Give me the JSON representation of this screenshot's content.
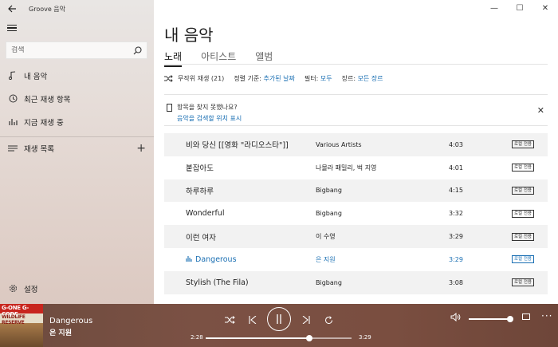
{
  "app": {
    "title": "Groove 음악"
  },
  "window_controls": {
    "minimize": "—",
    "maximize": "☐",
    "close": "✕"
  },
  "sidebar": {
    "search_placeholder": "검색",
    "items": [
      {
        "label": "내 음악",
        "icon": "music-note-icon"
      },
      {
        "label": "최근 재생 항목",
        "icon": "clock-icon"
      },
      {
        "label": "지금 재생 중",
        "icon": "bar-chart-icon"
      },
      {
        "label": "재생 목록",
        "icon": "playlist-icon"
      }
    ],
    "settings_label": "설정"
  },
  "main": {
    "title": "내 음악",
    "tabs": [
      {
        "label": "노래",
        "active": true
      },
      {
        "label": "아티스트",
        "active": false
      },
      {
        "label": "앨범",
        "active": false
      }
    ],
    "filters": {
      "shuffle_label": "무작위 재생 (21)",
      "sort_label": "정렬 기준:",
      "sort_value": "추가된 날짜",
      "filter_label": "필터:",
      "filter_value": "모두",
      "genre_label": "장르:",
      "genre_value": "모든 장르"
    },
    "notice": {
      "title": "항목을 찾지 못했나요?",
      "link": "음악을 검색할 위치 표시"
    },
    "songs": [
      {
        "title": "비와 당신 [[영화 \"라디오스타\"]]",
        "artist": "Various Artists",
        "duration": "4:03",
        "badge": "로컬 전용"
      },
      {
        "title": "붙잡아도",
        "artist": "나몰라 패밀리, 벅 지영",
        "duration": "4:01",
        "badge": "로컬 전용"
      },
      {
        "title": "하루하루",
        "artist": "Bigbang",
        "duration": "4:15",
        "badge": "로컬 전용"
      },
      {
        "title": "Wonderful",
        "artist": "Bigbang",
        "duration": "3:32",
        "badge": "로컬 전용"
      },
      {
        "title": "이런 여자",
        "artist": "이 수영",
        "duration": "3:29",
        "badge": "로컬 전용"
      },
      {
        "title": "Dangerous",
        "artist": "은 지원",
        "duration": "3:29",
        "badge": "로컬 전용",
        "playing": true
      },
      {
        "title": "Stylish (The Fila)",
        "artist": "Bigbang",
        "duration": "3:08",
        "badge": "로컬 전용"
      }
    ]
  },
  "player": {
    "album_art_text": "G-ONE G-CODE",
    "album_art_text2": "WILDLIFE RESERVE",
    "now_playing_title": "Dangerous",
    "now_playing_artist": "은 지원",
    "time_current": "2:28",
    "time_total": "3:29",
    "progress_fraction": 0.71,
    "volume_fraction": 1.0
  }
}
